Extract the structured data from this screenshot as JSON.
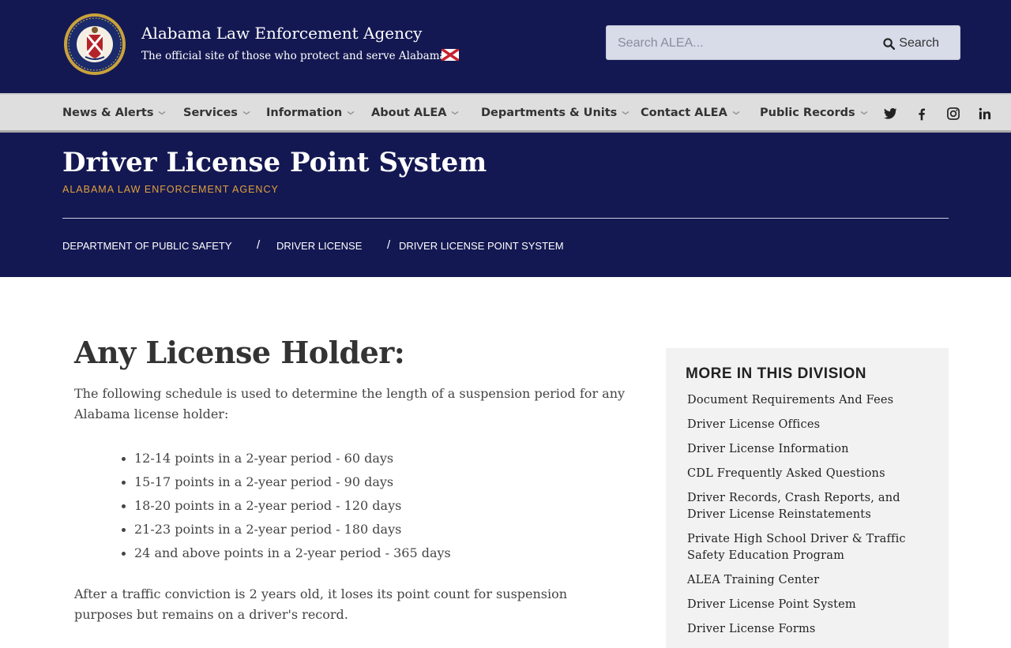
{
  "header": {
    "site_title": "Alabama Law Enforcement Agency",
    "tagline": "The official site of those who protect and serve Alabama",
    "seal_icon": "alea-seal-icon",
    "flag_icon": "alabama-flag-icon",
    "search": {
      "placeholder": "Search ALEA...",
      "value": "",
      "button_label": "Search"
    }
  },
  "nav": {
    "items": [
      {
        "label": "News & Alerts"
      },
      {
        "label": "Services"
      },
      {
        "label": "Information"
      },
      {
        "label": "About ALEA"
      },
      {
        "label": "Departments & Units"
      },
      {
        "label": "Contact ALEA"
      },
      {
        "label": "Public Records"
      }
    ],
    "social": [
      "twitter-icon",
      "facebook-icon",
      "instagram-icon",
      "linkedin-icon"
    ]
  },
  "hero": {
    "title": "Driver License Point System",
    "subtitle": "ALABAMA LAW ENFORCEMENT AGENCY",
    "breadcrumbs": [
      "DEPARTMENT OF PUBLIC SAFETY",
      "DRIVER LICENSE",
      "DRIVER LICENSE POINT SYSTEM"
    ],
    "separator": "/"
  },
  "main": {
    "heading": "Any License Holder:",
    "intro": "The following schedule is used to determine the length of a suspension period for any Alabama license holder:",
    "schedule": [
      "12-14 points in a 2-year period - 60 days",
      "15-17 points in a 2-year period - 90 days",
      "18-20 points in a 2-year period - 120 days",
      "21-23 points in a 2-year period - 180 days",
      "24 and above points in a 2-year period - 365 days"
    ],
    "closing": "After a traffic conviction is 2 years old, it loses its point count for suspension purposes but remains on a driver's record."
  },
  "sidebar": {
    "title": "MORE IN THIS DIVISION",
    "links": [
      "Document Requirements And Fees",
      "Driver License Offices",
      "Driver License Information",
      "CDL Frequently Asked Questions",
      "Driver Records, Crash Reports, and Driver License Reinstatements",
      "Private High School Driver & Traffic Safety Education Program",
      "ALEA Training Center",
      "Driver License Point System",
      "Driver License Forms"
    ]
  },
  "colors": {
    "navy": "#141852",
    "accent_gold": "#e0a13c",
    "nav_bg": "#dedede",
    "sidebar_bg": "#f2f2f2"
  }
}
